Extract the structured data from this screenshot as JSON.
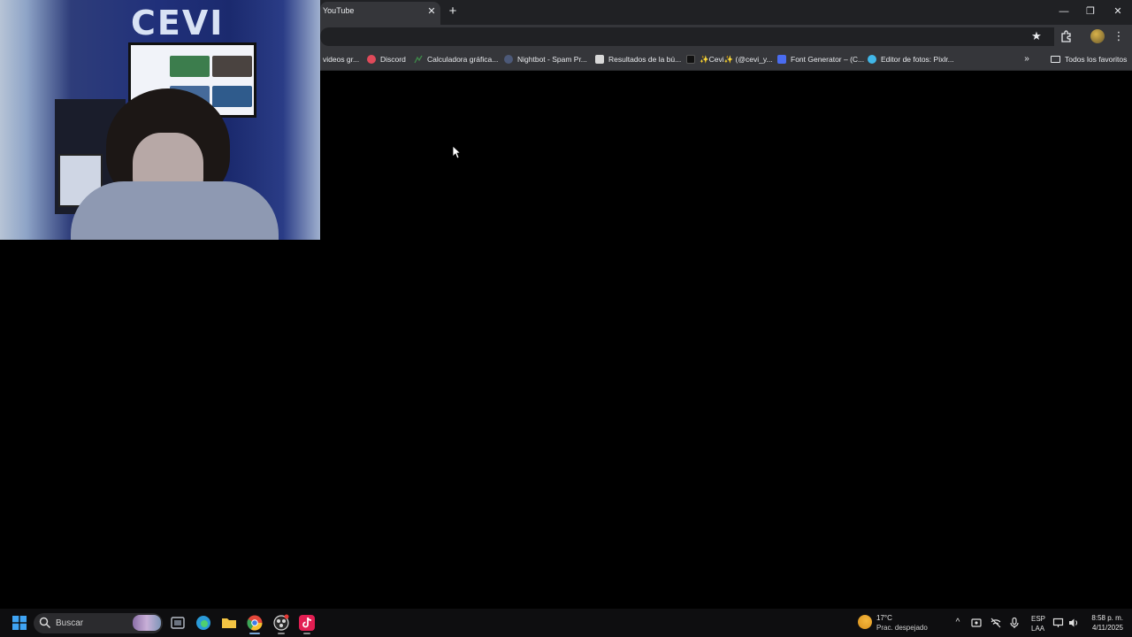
{
  "browser": {
    "tab": {
      "title": "YouTube",
      "close_glyph": "✕"
    },
    "new_tab_glyph": "+",
    "window_controls": {
      "minimize": "—",
      "maximize": "❐",
      "close": "✕"
    },
    "toolbar": {
      "star_glyph": "★",
      "menu_glyph": "⋮"
    },
    "bookmarks": [
      {
        "label": "videos gr...",
        "icon": "page-icon"
      },
      {
        "label": "Discord",
        "icon": "discord-icon",
        "color": "#e04a5a"
      },
      {
        "label": "Calculadora gráfica...",
        "icon": "desmos-icon",
        "color": "#3f8a4a"
      },
      {
        "label": "Nightbot - Spam Pr...",
        "icon": "nightbot-icon",
        "color": "#6f7fa8"
      },
      {
        "label": "Resultados de la bú...",
        "icon": "document-icon",
        "color": "#d8d8d8"
      },
      {
        "label": "✨Cevi✨ (@cevi_y...",
        "icon": "tiktok-icon",
        "color": "#111111"
      },
      {
        "label": "Font Generator – (C...",
        "icon": "font-generator-icon",
        "color": "#4a6cf0"
      },
      {
        "label": "Editor de fotos: Pixlr...",
        "icon": "pixlr-icon",
        "color": "#41b7e8"
      }
    ],
    "bookmarks_overflow_glyph": "»",
    "all_bookmarks_label": "Todos los favoritos"
  },
  "webcam": {
    "sign_text": "CEVI"
  },
  "taskbar": {
    "search_label": "Buscar",
    "apps": [
      {
        "name": "task-view",
        "color": "#6b7380"
      },
      {
        "name": "edge",
        "color": "#2a9ad8"
      },
      {
        "name": "file-explorer",
        "color": "#f3c443"
      },
      {
        "name": "chrome",
        "color": "#e4473a"
      },
      {
        "name": "obs",
        "color": "#3a3a3a"
      },
      {
        "name": "tiktok",
        "color": "#e21e52"
      }
    ],
    "weather": {
      "temperature": "17°C",
      "condition": "Prac. despejado"
    },
    "tray": {
      "chevron": "^"
    },
    "language": {
      "line1": "ESP",
      "line2": "LAA"
    },
    "clock": {
      "time": "8:58 p. m.",
      "date": "4/11/2025"
    }
  },
  "colors": {
    "chrome_dark": "#202124",
    "chrome_toolbar": "#35363a",
    "page_background": "#000000",
    "taskbar": "#0e0e10"
  }
}
